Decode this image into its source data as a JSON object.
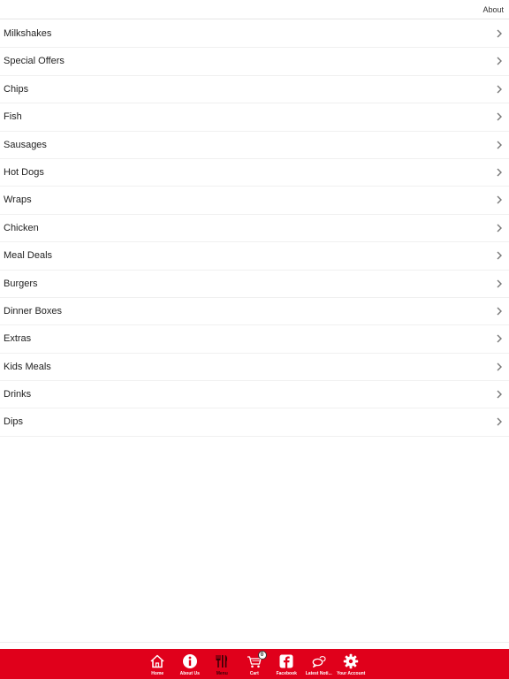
{
  "header": {
    "about_label": "About"
  },
  "menu": {
    "items": [
      {
        "label": "Milkshakes"
      },
      {
        "label": "Special Offers"
      },
      {
        "label": "Chips"
      },
      {
        "label": "Fish"
      },
      {
        "label": "Sausages"
      },
      {
        "label": "Hot Dogs"
      },
      {
        "label": "Wraps"
      },
      {
        "label": "Chicken"
      },
      {
        "label": "Meal Deals"
      },
      {
        "label": "Burgers"
      },
      {
        "label": "Dinner Boxes"
      },
      {
        "label": "Extras"
      },
      {
        "label": "Kids Meals"
      },
      {
        "label": "Drinks"
      },
      {
        "label": "Dips"
      }
    ],
    "chevron_icon": "chevron-right-icon"
  },
  "tabbar": {
    "background": "#e0001b",
    "tabs": [
      {
        "label": "Home",
        "icon": "home-icon"
      },
      {
        "label": "About Us",
        "icon": "info-icon"
      },
      {
        "label": "Menu",
        "icon": "cutlery-icon",
        "active": true
      },
      {
        "label": "Cart",
        "icon": "cart-icon",
        "badge": "0"
      },
      {
        "label": "Facebook",
        "icon": "facebook-icon"
      },
      {
        "label": "Latest Noti...",
        "icon": "notification-icon"
      },
      {
        "label": "Your Account",
        "icon": "gear-icon"
      }
    ]
  }
}
